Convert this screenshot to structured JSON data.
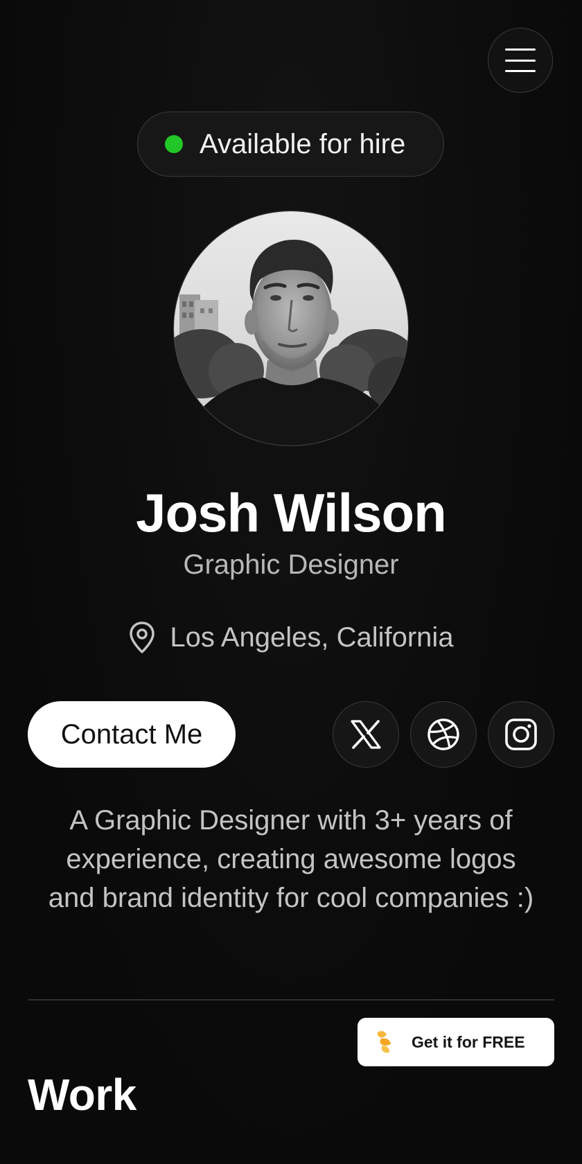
{
  "nav": {
    "menu_icon": "hamburger-menu-icon"
  },
  "status": {
    "label": "Available for hire",
    "dot_color": "#22c727"
  },
  "profile": {
    "name": "Josh Wilson",
    "role": "Graphic Designer",
    "location": "Los Angeles, California",
    "location_icon": "map-pin-icon",
    "avatar": "portrait-photo"
  },
  "actions": {
    "contact_label": "Contact Me"
  },
  "social": [
    {
      "name": "x-twitter-icon"
    },
    {
      "name": "dribbble-icon"
    },
    {
      "name": "instagram-icon"
    }
  ],
  "bio": {
    "line1": "A Graphic Designer with 3+ years of",
    "line2": "experience, creating awesome logos",
    "line3": "and brand identity for cool companies :)"
  },
  "promo": {
    "label": "Get it for FREE",
    "icon": "framer-logo-icon",
    "icon_color": "#f6b73c"
  },
  "work": {
    "title": "Work"
  },
  "colors": {
    "background": "#0b0b0b",
    "text_primary": "#ffffff",
    "text_secondary": "#c4c4c4",
    "border": "#3a3a3a"
  }
}
